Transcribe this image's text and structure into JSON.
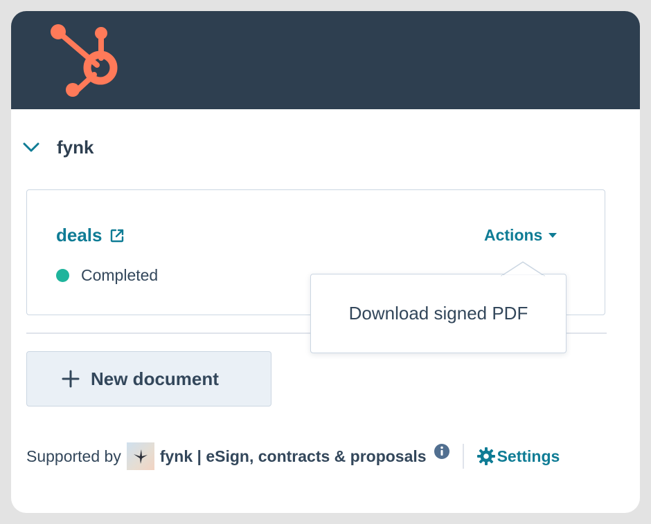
{
  "brand": {
    "logo_icon": "hubspot-sprocket-icon",
    "topbar_color": "#2e3f50",
    "logo_color": "#ff7a59"
  },
  "section": {
    "title": "fynk",
    "toggle_icon": "chevron-down-icon"
  },
  "document": {
    "name": "deals",
    "link_icon": "external-link-icon",
    "status": "Completed",
    "status_color": "#1fb49c",
    "actions_label": "Actions",
    "actions_icon": "caret-down-icon"
  },
  "actions_menu": {
    "items": [
      {
        "label": "Download signed PDF"
      }
    ]
  },
  "new_document": {
    "label": "New document",
    "icon": "plus-icon"
  },
  "footer": {
    "supported_by": "Supported by",
    "app_icon": "fynk-app-logo",
    "app_name": "fynk | eSign, contracts & proposals",
    "info_icon": "info-icon",
    "settings_label": "Settings",
    "settings_icon": "gear-icon"
  },
  "colors": {
    "accent": "#0f7c95",
    "text": "#33475b",
    "border": "#cbd6e2"
  }
}
